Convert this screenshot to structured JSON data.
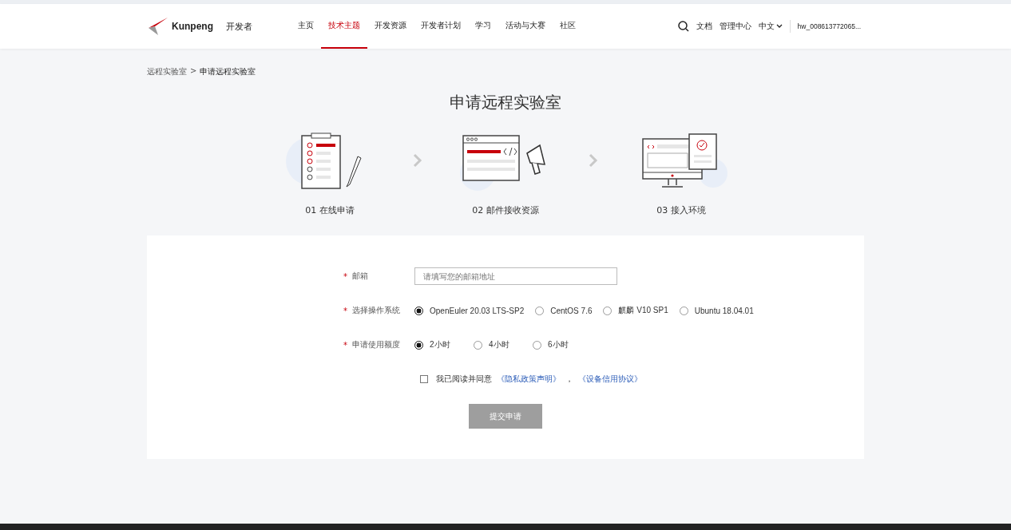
{
  "header": {
    "brand": "Kunpeng",
    "product": "开发者",
    "nav": [
      {
        "label": "主页",
        "selected": false
      },
      {
        "label": "技术主题",
        "selected": true
      },
      {
        "label": "开发资源",
        "selected": false
      },
      {
        "label": "开发者计划",
        "selected": false
      },
      {
        "label": "学习",
        "selected": false
      },
      {
        "label": "活动与大赛",
        "selected": false
      },
      {
        "label": "社区",
        "selected": false
      }
    ],
    "links": [
      "文档",
      "管理中心"
    ],
    "language": "中文",
    "user": "hw_008613772065..."
  },
  "breadcrumb": [
    "远程实验室",
    "申请远程实验室"
  ],
  "breadcrumb_separator": ">",
  "title": "申请远程实验室",
  "steps": [
    {
      "kind": "form",
      "label": "01 在线申请"
    },
    {
      "kind": "mail",
      "label": "02 邮件接收资源"
    },
    {
      "kind": "monitor",
      "label": "03  接入环境"
    }
  ],
  "form": {
    "required_mark": "*",
    "email": {
      "label": "邮箱",
      "placeholder": "请填写您的邮箱地址"
    },
    "os": {
      "label": "选择操作系统",
      "options": [
        {
          "label": "OpenEuler 20.03 LTS-SP2",
          "selected": true
        },
        {
          "label": "CentOS 7.6",
          "selected": false
        },
        {
          "label": "麒麟 V10 SP1",
          "selected": false
        },
        {
          "label": "Ubuntu 18.04.01",
          "selected": false
        }
      ]
    },
    "quota": {
      "label": "申请使用额度",
      "options": [
        {
          "label": "2小时",
          "selected": true
        },
        {
          "label": "4小时",
          "selected": false
        },
        {
          "label": "6小时",
          "selected": false
        }
      ]
    },
    "agreement": {
      "checked": false,
      "text": "我已阅读并同意",
      "links": [
        "《隐私政策声明》",
        "《设备信用协议》"
      ],
      "separator": "，"
    },
    "submit": {
      "label": "提交申请",
      "disabled": true
    }
  }
}
